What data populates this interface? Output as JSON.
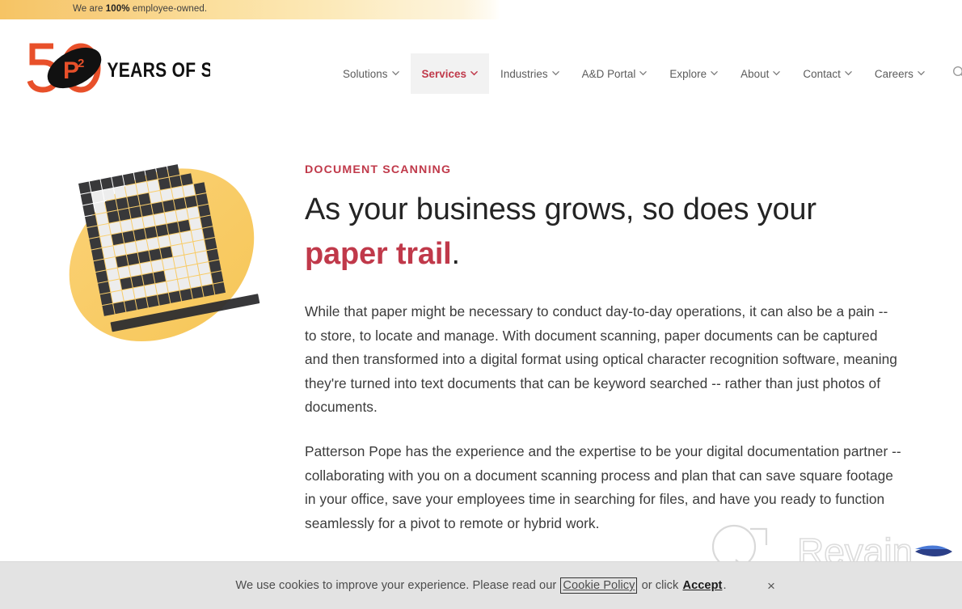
{
  "announcement": {
    "prefix": "We are ",
    "emphasis": "100%",
    "suffix": " employee-owned."
  },
  "header": {
    "logo": {
      "number": "50",
      "monogram": "P",
      "monogram_superscript": "2",
      "wordmark": "YEARS OF STUFF"
    },
    "nav": [
      {
        "label": "Solutions",
        "has_dropdown": true,
        "active": false
      },
      {
        "label": "Services",
        "has_dropdown": true,
        "active": true
      },
      {
        "label": "Industries",
        "has_dropdown": true,
        "active": false
      },
      {
        "label": "A&D Portal",
        "has_dropdown": true,
        "active": false
      },
      {
        "label": "Explore",
        "has_dropdown": true,
        "active": false
      },
      {
        "label": "About",
        "has_dropdown": true,
        "active": false
      },
      {
        "label": "Contact",
        "has_dropdown": true,
        "active": false
      },
      {
        "label": "Careers",
        "has_dropdown": true,
        "active": false
      }
    ],
    "search_icon": "search-icon"
  },
  "hero": {
    "eyebrow": "DOCUMENT SCANNING",
    "headline_line1": "As your business grows, so does your",
    "headline_accent": "paper trail",
    "headline_period": ".",
    "paragraphs": [
      "While that paper might be necessary to conduct day-to-day operations, it can also be a pain -- to store, to locate and manage. With document scanning, paper documents can be captured and then transformed into a digital format using optical character recognition software, meaning they're turned into text documents that can be keyword searched -- rather than just photos of documents.",
      "Patterson Pope has the experience and the expertise to be your digital documentation partner -- collaborating with you on a document scanning process and plan that can save square footage in your office, save your employees time in searching for files, and have you ready to function seamlessly for a pivot to remote or hybrid work."
    ],
    "illustration_alt": "pixelated-document-icon-on-yellow-blob"
  },
  "watermark": {
    "text": "Revain"
  },
  "cookie_banner": {
    "message_before": "We use cookies to improve your experience. Please read our ",
    "policy_link": "Cookie Policy",
    "message_middle": " or click ",
    "accept_label": "Accept",
    "message_after": ".",
    "close_glyph": "×"
  },
  "colors": {
    "brand_red": "#c0394a",
    "logo_orange": "#e8502a",
    "accent_yellow": "#f8cd62",
    "banner_gradient_start": "#f6c464",
    "nav_text": "#5b5b5b",
    "nav_active_bg": "#f2f2f2",
    "body_text": "#3b3b3b",
    "heading_text": "#242424",
    "cookie_bg": "#e3e3e3",
    "doc_dark": "#38383a",
    "doc_light": "#f0f0f0"
  }
}
